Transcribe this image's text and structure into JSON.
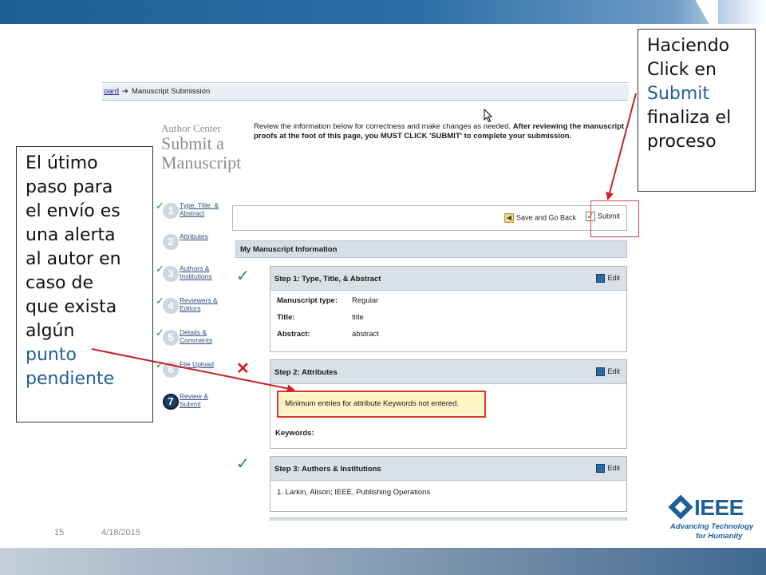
{
  "breadcrumb": {
    "link": "oard",
    "current": "Manuscript Submission"
  },
  "author_center": {
    "label": "Author Center",
    "title": "Submit a Manuscript"
  },
  "intro": {
    "normal": "Review the information below for correctness and make changes as needed. ",
    "bold": "After reviewing the manuscript proofs at the foot of this page, you MUST CLICK 'SUBMIT' to complete your submission."
  },
  "steps": [
    {
      "num": "1",
      "label": "Type, Title, & Abstract",
      "checked": true
    },
    {
      "num": "2",
      "label": "Attributes",
      "checked": false
    },
    {
      "num": "3",
      "label": "Authors & Institutions",
      "checked": true
    },
    {
      "num": "4",
      "label": "Reviewers & Editors",
      "checked": true
    },
    {
      "num": "5",
      "label": "Details & Comments",
      "checked": true
    },
    {
      "num": "6",
      "label": "File Upload",
      "checked": true
    },
    {
      "num": "7",
      "label": "Review & Submit",
      "checked": false
    }
  ],
  "actions": {
    "save_back": "Save and Go Back",
    "submit": "Submit"
  },
  "info_header": "My Manuscript Information",
  "panels": {
    "step1": {
      "title": "Step 1: Type, Title, & Abstract",
      "edit": "Edit",
      "rows": [
        {
          "k": "Manuscript type:",
          "v": "Regular"
        },
        {
          "k": "Title:",
          "v": "title"
        },
        {
          "k": "Abstract:",
          "v": "abstract"
        }
      ]
    },
    "step2": {
      "title": "Step 2: Attributes",
      "edit": "Edit",
      "alert": "Minimum entries for attribute Keywords not entered.",
      "keywords_label": "Keywords:"
    },
    "step3": {
      "title": "Step 3: Authors & Institutions",
      "edit": "Edit",
      "author": "1.  Larkin, Alison; IEEE, Publishing Operations"
    }
  },
  "callout_left": {
    "lines": [
      "El útimo",
      "paso para",
      "el envío es",
      "una alerta",
      "al autor en",
      "caso de",
      "que exista",
      "algún"
    ],
    "highlight": [
      "punto",
      "pendiente"
    ]
  },
  "callout_right": {
    "lines": [
      "Haciendo",
      "Click en"
    ],
    "highlight": "Submit",
    "tail": [
      "finaliza el",
      "proceso"
    ]
  },
  "footer": {
    "slide_number": "15",
    "date": "4/18/2015"
  },
  "logo": {
    "word": "IEEE",
    "tag_line1": "Advancing Technology",
    "tag_line2": "for Humanity"
  },
  "colors": {
    "accent": "#1f5f9a",
    "check": "#2e8b2e",
    "error": "#d02020",
    "arrow": "#c8202a"
  }
}
